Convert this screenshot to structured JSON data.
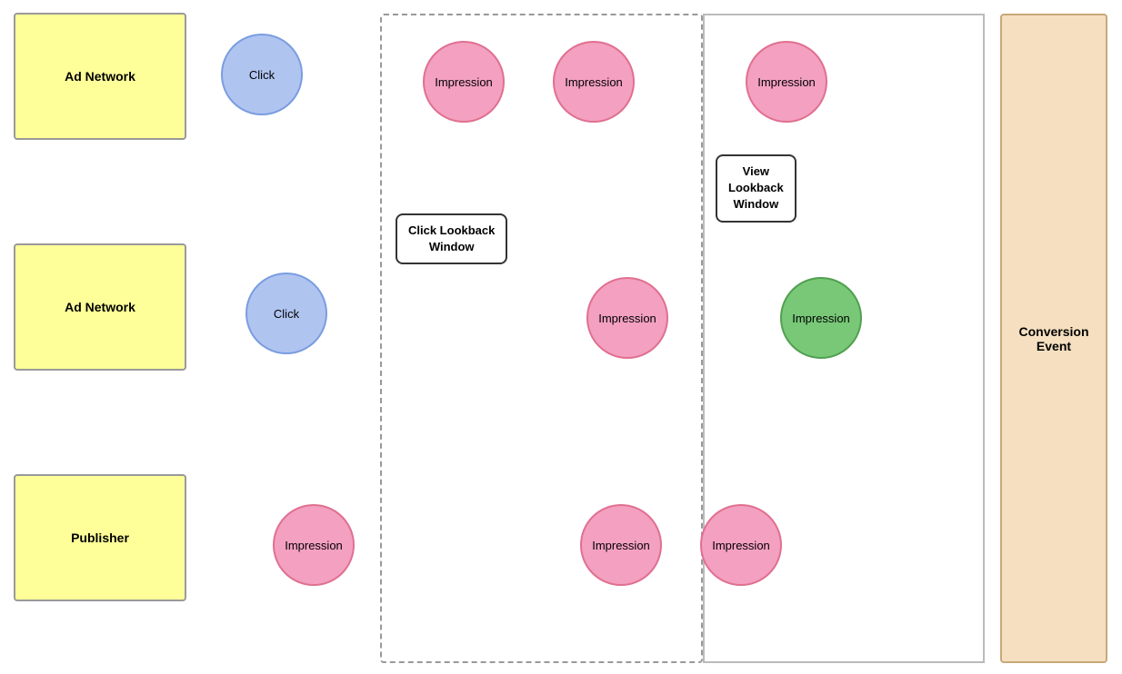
{
  "entities": {
    "ad_network_top": {
      "label": "Ad Network"
    },
    "ad_network_mid": {
      "label": "Ad Network"
    },
    "publisher": {
      "label": "Publisher"
    }
  },
  "circles": {
    "click_top": {
      "label": "Click",
      "type": "blue"
    },
    "click_mid": {
      "label": "Click",
      "type": "blue"
    },
    "impression_row1_col1": {
      "label": "Impression",
      "type": "pink"
    },
    "impression_row1_col2": {
      "label": "Impression",
      "type": "pink"
    },
    "impression_row1_col3": {
      "label": "Impression",
      "type": "pink"
    },
    "impression_row2_col2": {
      "label": "Impression",
      "type": "pink"
    },
    "impression_row2_col3_green": {
      "label": "Impression",
      "type": "green"
    },
    "impression_row3_col1": {
      "label": "Impression",
      "type": "pink"
    },
    "impression_row3_col2": {
      "label": "Impression",
      "type": "pink"
    },
    "impression_row3_col3": {
      "label": "Impression",
      "type": "pink"
    }
  },
  "labels": {
    "click_lookback": {
      "line1": "Click Lookback",
      "line2": "Window"
    },
    "view_lookback": {
      "line1": "View",
      "line2": "Lookback",
      "line3": "Window"
    }
  },
  "conversion": {
    "label": "Conversion\nEvent"
  }
}
